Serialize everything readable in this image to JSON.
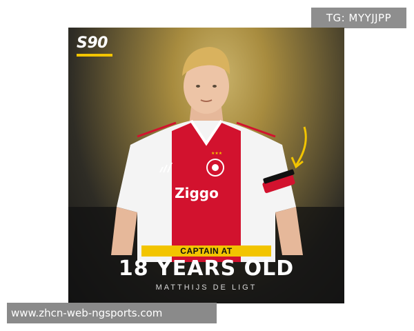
{
  "watermark_top": "TG: MYYJJPP",
  "watermark_bottom": "www.zhcn-web-ngsports.com",
  "poster": {
    "logo": "S90",
    "shirt_sponsor": "Ziggo",
    "caption_ribbon": "CAPTAIN AT",
    "headline": "18 YEARS OLD",
    "name": "MATTHIJS DE LIGT",
    "colors": {
      "accent": "#f2c400",
      "shirt_red": "#d2122e",
      "background_gold": "#a88c3f"
    },
    "icons": [
      "arrow-icon",
      "captain-armband-icon",
      "adidas-logo-icon",
      "ajax-crest-icon"
    ]
  }
}
